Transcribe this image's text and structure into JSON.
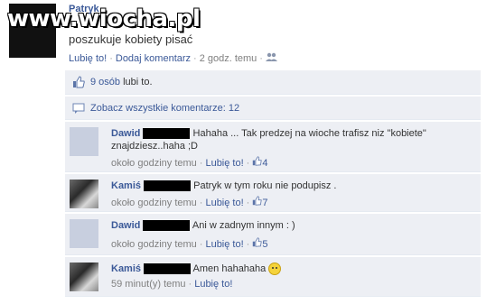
{
  "watermark": "www.wiocha.pl",
  "post": {
    "author": "Patryk",
    "text": "poszukuje kobiety pisać",
    "like_link": "Lubię to!",
    "comment_link": "Dodaj komentarz",
    "time": "2 godz. temu",
    "audience_icon": "friends-icon"
  },
  "ufi": {
    "likes_count": "9 osób",
    "likes_suffix": " lubi to.",
    "view_all": "Zobacz wszystkie komentarze: 12"
  },
  "comments": [
    {
      "author": "Dawid",
      "text": " Hahaha ... Tak predzej na wioche trafisz niz \"kobiete\" znajdziesz..haha ;D",
      "time": "około godziny temu",
      "like_link": "Lubię to!",
      "likes": "4",
      "avatar": "default"
    },
    {
      "author": "Kamiś",
      "text": " Patryk w tym roku nie podupisz .",
      "time": "około godziny temu",
      "like_link": "Lubię to!",
      "likes": "7",
      "avatar": "photo"
    },
    {
      "author": "Dawid",
      "text": " Ani w zadnym innym : )",
      "time": "około godziny temu",
      "like_link": "Lubię to!",
      "likes": "5",
      "avatar": "default"
    },
    {
      "author": "Kamiś",
      "text": " Amen hahahaha",
      "time": "59 minut(y) temu",
      "like_link": "Lubię to!",
      "likes": "",
      "avatar": "photo"
    }
  ],
  "colors": {
    "link": "#3b5998",
    "panel": "#edeff4"
  }
}
